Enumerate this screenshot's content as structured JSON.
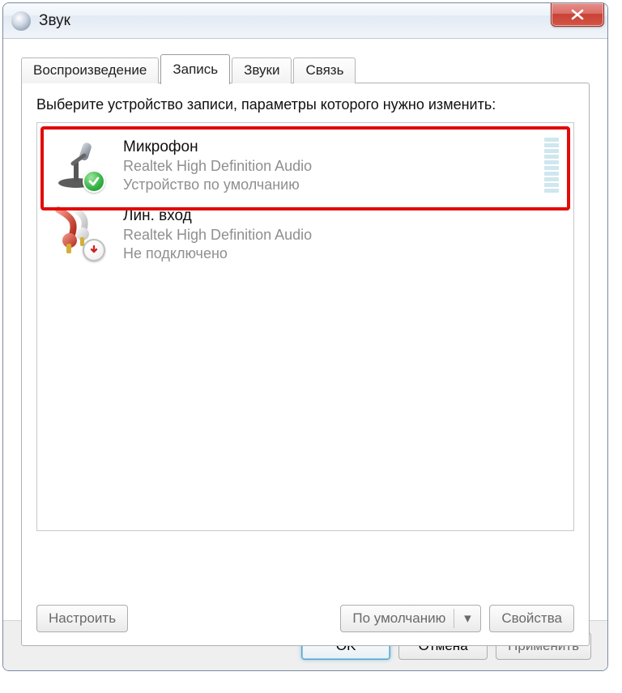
{
  "window": {
    "title": "Звук"
  },
  "tabs": [
    {
      "label": "Воспроизведение"
    },
    {
      "label": "Запись"
    },
    {
      "label": "Звуки"
    },
    {
      "label": "Связь"
    }
  ],
  "active_tab_index": 1,
  "panel": {
    "instruction": "Выберите устройство записи, параметры которого нужно изменить:",
    "devices": [
      {
        "name": "Микрофон",
        "driver": "Realtek High Definition Audio",
        "status": "Устройство по умолчанию",
        "icon": "microphone-icon",
        "badge": "default",
        "has_meter": true,
        "highlight": true
      },
      {
        "name": "Лин. вход",
        "driver": "Realtek High Definition Audio",
        "status": "Не подключено",
        "icon": "line-in-icon",
        "badge": "unplugged",
        "has_meter": false,
        "highlight": false
      }
    ],
    "buttons": {
      "configure": "Настроить",
      "set_default": "По умолчанию",
      "properties": "Свойства"
    }
  },
  "footer": {
    "ok": "OK",
    "cancel": "Отмена",
    "apply": "Применить"
  }
}
